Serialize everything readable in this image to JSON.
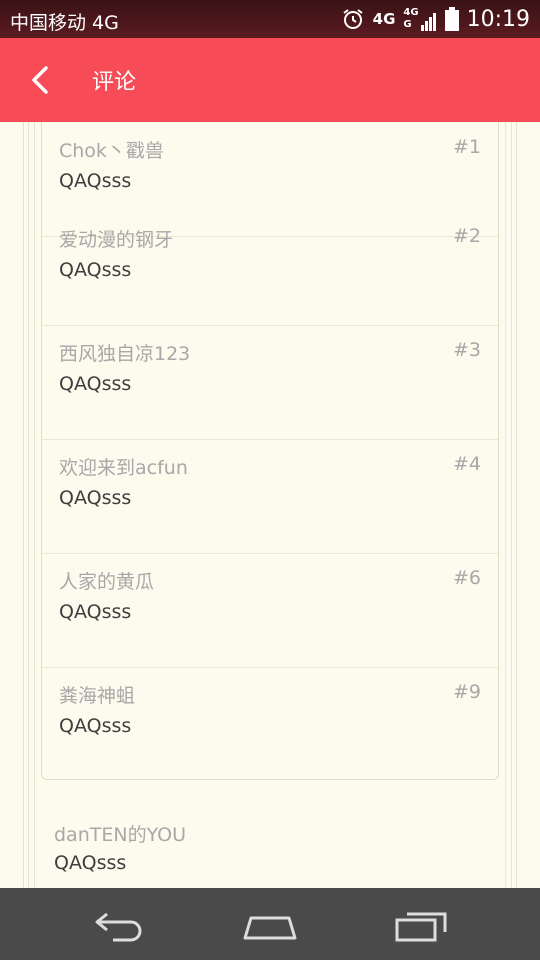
{
  "status_bar": {
    "carrier": "中国移动 4G",
    "time": "10:19",
    "network_top": "4G",
    "network_small_top": "4G",
    "network_small_bottom": "G",
    "icons": [
      "alarm-icon",
      "signal-icon",
      "battery-icon"
    ]
  },
  "toolbar": {
    "title": "评论",
    "back_icon": "back-arrow-icon",
    "color": "#f74b57"
  },
  "comments": [
    {
      "author": "Chok丶戳兽",
      "floor": "#1",
      "text": "QAQsss"
    },
    {
      "author": "爱动漫的钢牙",
      "floor": "#2",
      "text": "QAQsss"
    },
    {
      "author": "西风独自凉123",
      "floor": "#3",
      "text": "QAQsss"
    },
    {
      "author": "欢迎来到acfun",
      "floor": "#4",
      "text": "QAQsss"
    },
    {
      "author": "人家的黄瓜",
      "floor": "#6",
      "text": "QAQsss"
    },
    {
      "author": "粪海神蛆",
      "floor": "#9",
      "text": "QAQsss"
    }
  ],
  "outer_comment": {
    "author": "danTEN的YOU",
    "text": "QAQsss"
  },
  "fab": {
    "icon": "add-comment-icon"
  },
  "navbar": {
    "icons": [
      "nav-back-icon",
      "nav-home-icon",
      "nav-recents-icon"
    ]
  }
}
